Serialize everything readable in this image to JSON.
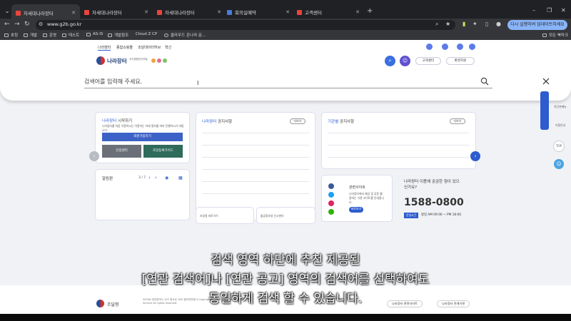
{
  "browser": {
    "tabs": [
      {
        "label": "차세대나라장터",
        "fav_color": "#e8453c",
        "active": true
      },
      {
        "label": "차세대나라장터",
        "fav_color": "#e8453c",
        "active": false
      },
      {
        "label": "차세대나라장터",
        "fav_color": "#e8453c",
        "active": false
      },
      {
        "label": "회의실예약",
        "fav_color": "#4a7bd8",
        "active": false
      },
      {
        "label": "고객센터",
        "fav_color": "#e8453c",
        "active": false
      }
    ],
    "new_tab": "+",
    "win_min": "–",
    "win_max": "❐",
    "win_close": "✕",
    "url": "www.g2b.go.kr",
    "update_button": "다시 실행하여 업데이트하세요",
    "bookmarks": [
      "호칭",
      "개발",
      "운영",
      "테스트",
      "AS-IS",
      "개발참조",
      "Cloud Z CP",
      "클라우드 온나라 문..."
    ],
    "bookmarks_all": "모든 북마크"
  },
  "site": {
    "topmenu": [
      "나라장터",
      "종합쇼핑몰",
      "조달데이터허브",
      "혁신"
    ],
    "logo_text": "나라장터",
    "logo_sub": "국가종합전자조달",
    "customer_center": "고객센터",
    "env_settings": "환경지원"
  },
  "search": {
    "placeholder": "검색어를 입력해 주세요.",
    "value": ""
  },
  "cards": {
    "start_title_blue": "나라장터",
    "start_title_rest": " 시작하기",
    "start_desc": "나라장터를 처음 이용하시는 이용자는 아래 절차를 따라 진행하시기 바랍니다.",
    "member_btn": "회원가입하기",
    "auth_btn": "인증센터",
    "guide_btn": "조달등록가이드",
    "notice_title_blue": "나라장터",
    "notice_title_rest": " 공지사항",
    "org_notice_blue": "기관별",
    "org_notice_rest": " 공지사항",
    "more": "더보기",
    "alarm_title": "알림판",
    "alarm_pager": "3 / 7",
    "related_title": "관련사이트",
    "related_desc": "나라장터에서 제공 및 공동 활용하는 기관 사이트를 안내합니다.",
    "related_btn": "바로보기",
    "inquiry_q": "나라장터 이용에 궁금한 점이 있으신가요?",
    "phone": "1588-0800",
    "hours_label": "운영시간",
    "hours": "평일 AM 09:00 ~ PM 18:00",
    "banner1": "조달청 바로가기",
    "banner2": "불공정조달 신고센터"
  },
  "float": {
    "items": [
      "최근본메뉴",
      "이용안내"
    ],
    "top": "TOP"
  },
  "footer": {
    "org": "조달청",
    "address": "35208 대전광역시 서구 청사로 189 정부대전청사 Copyright 2023 Public Procurement Service All rights reserved.",
    "site_select": "나라장터 관련사이트",
    "org_select": "나라장터 연계기관"
  },
  "subtitles": [
    "검색 영역 하단에 추천 제공된",
    "[연관 검색어]나 [연관 공고] 영역의 검색어를 선택하여도",
    "동일하게 검색 할 수 있습니다."
  ],
  "colors": {
    "brand_blue": "#2d5ccf",
    "dark_green": "#2f6b5a",
    "gray_btn": "#6b7078"
  }
}
